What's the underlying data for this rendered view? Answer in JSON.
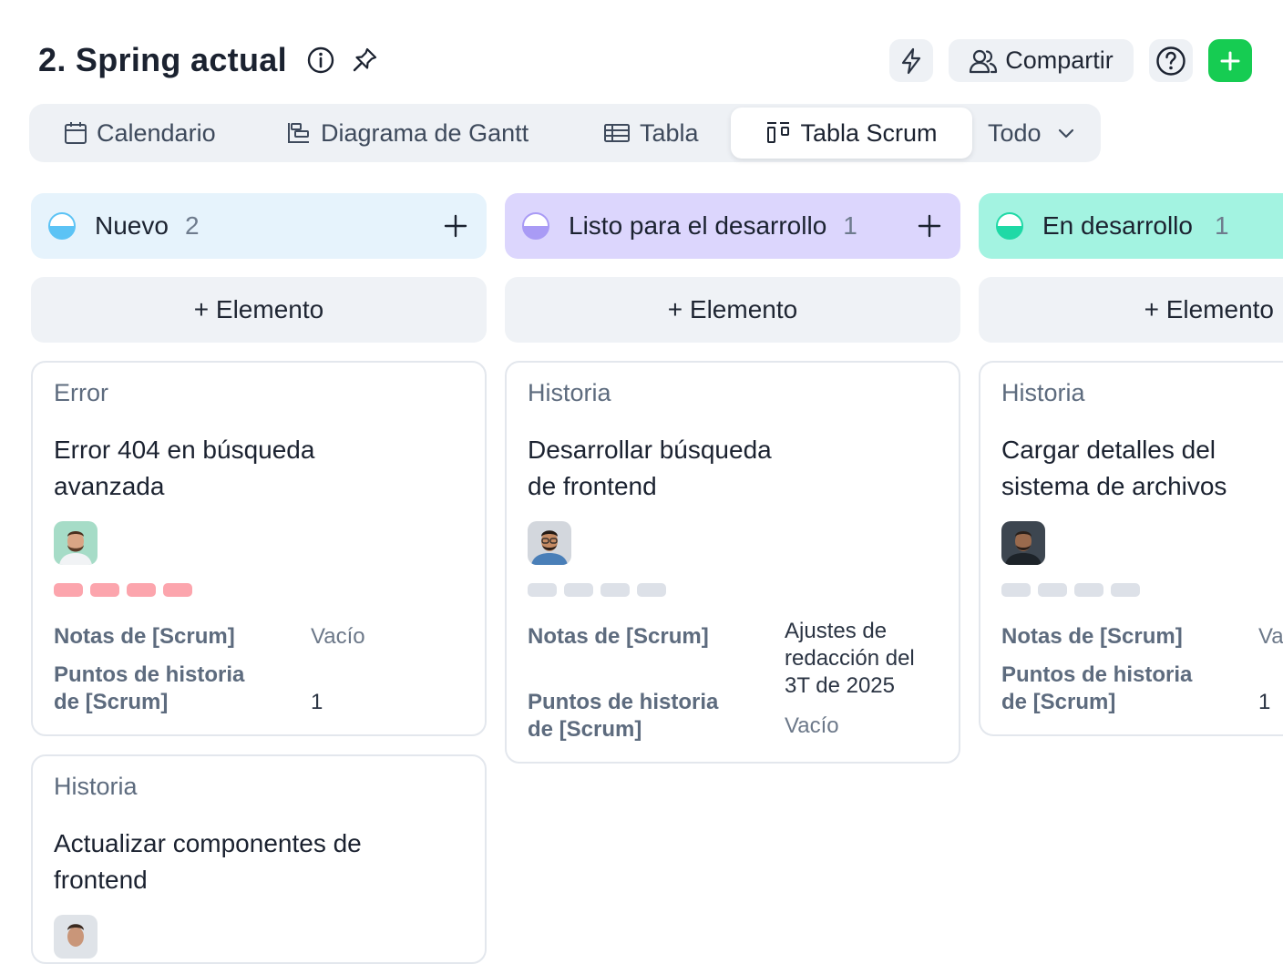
{
  "header": {
    "title": "2. Spring actual",
    "share_label": "Compartir",
    "icons": [
      "info-icon",
      "pin-icon",
      "lightning-icon",
      "users-icon",
      "help-icon",
      "plus-icon"
    ]
  },
  "tabs": [
    {
      "label": "Calendario",
      "icon": "calendar-icon"
    },
    {
      "label": "Diagrama de Gantt",
      "icon": "gantt-icon"
    },
    {
      "label": "Tabla",
      "icon": "table-icon"
    },
    {
      "label": "Tabla Scrum",
      "icon": "board-icon",
      "active": true
    },
    {
      "label": "Todo",
      "icon": "chevron-down-icon"
    }
  ],
  "add_item_label": "+ Elemento",
  "columns": [
    {
      "name": "Nuevo",
      "count": "2",
      "color": "#e6f3fc",
      "status_color": "#5cc3f5",
      "cards": [
        {
          "type": "Error",
          "title": "Error 404 en búsqueda avanzada",
          "priority_color": "#fca5ad",
          "field1_label": "Notas de [Scrum]",
          "field1_value": "Vacío",
          "field2_label": "Puntos de historia de [Scrum]",
          "field2_value": "1"
        },
        {
          "type": "Historia",
          "title": "Actualizar componentes de frontend"
        }
      ]
    },
    {
      "name": "Listo para el desarrollo",
      "count": "1",
      "color": "#dcd6fd",
      "status_color": "#a99bf5",
      "cards": [
        {
          "type": "Historia",
          "title": "Desarrollar búsqueda de frontend",
          "priority_color": "#dde1e8",
          "field1_label": "Notas de [Scrum]",
          "field1_value": "Ajustes de redacción del 3T de 2025",
          "field2_label": "Puntos de historia de [Scrum]",
          "field2_value": "Vacío"
        }
      ]
    },
    {
      "name": "En desarrollo",
      "count": "1",
      "color": "#a3f3e1",
      "status_color": "#1fd9a6",
      "cards": [
        {
          "type": "Historia",
          "title": "Cargar detalles del sistema de archivos",
          "priority_color": "#dde1e8",
          "field1_label": "Notas de [Scrum]",
          "field1_value": "Va",
          "field2_label": "Puntos de historia de [Scrum]",
          "field2_value": "1"
        }
      ]
    }
  ]
}
